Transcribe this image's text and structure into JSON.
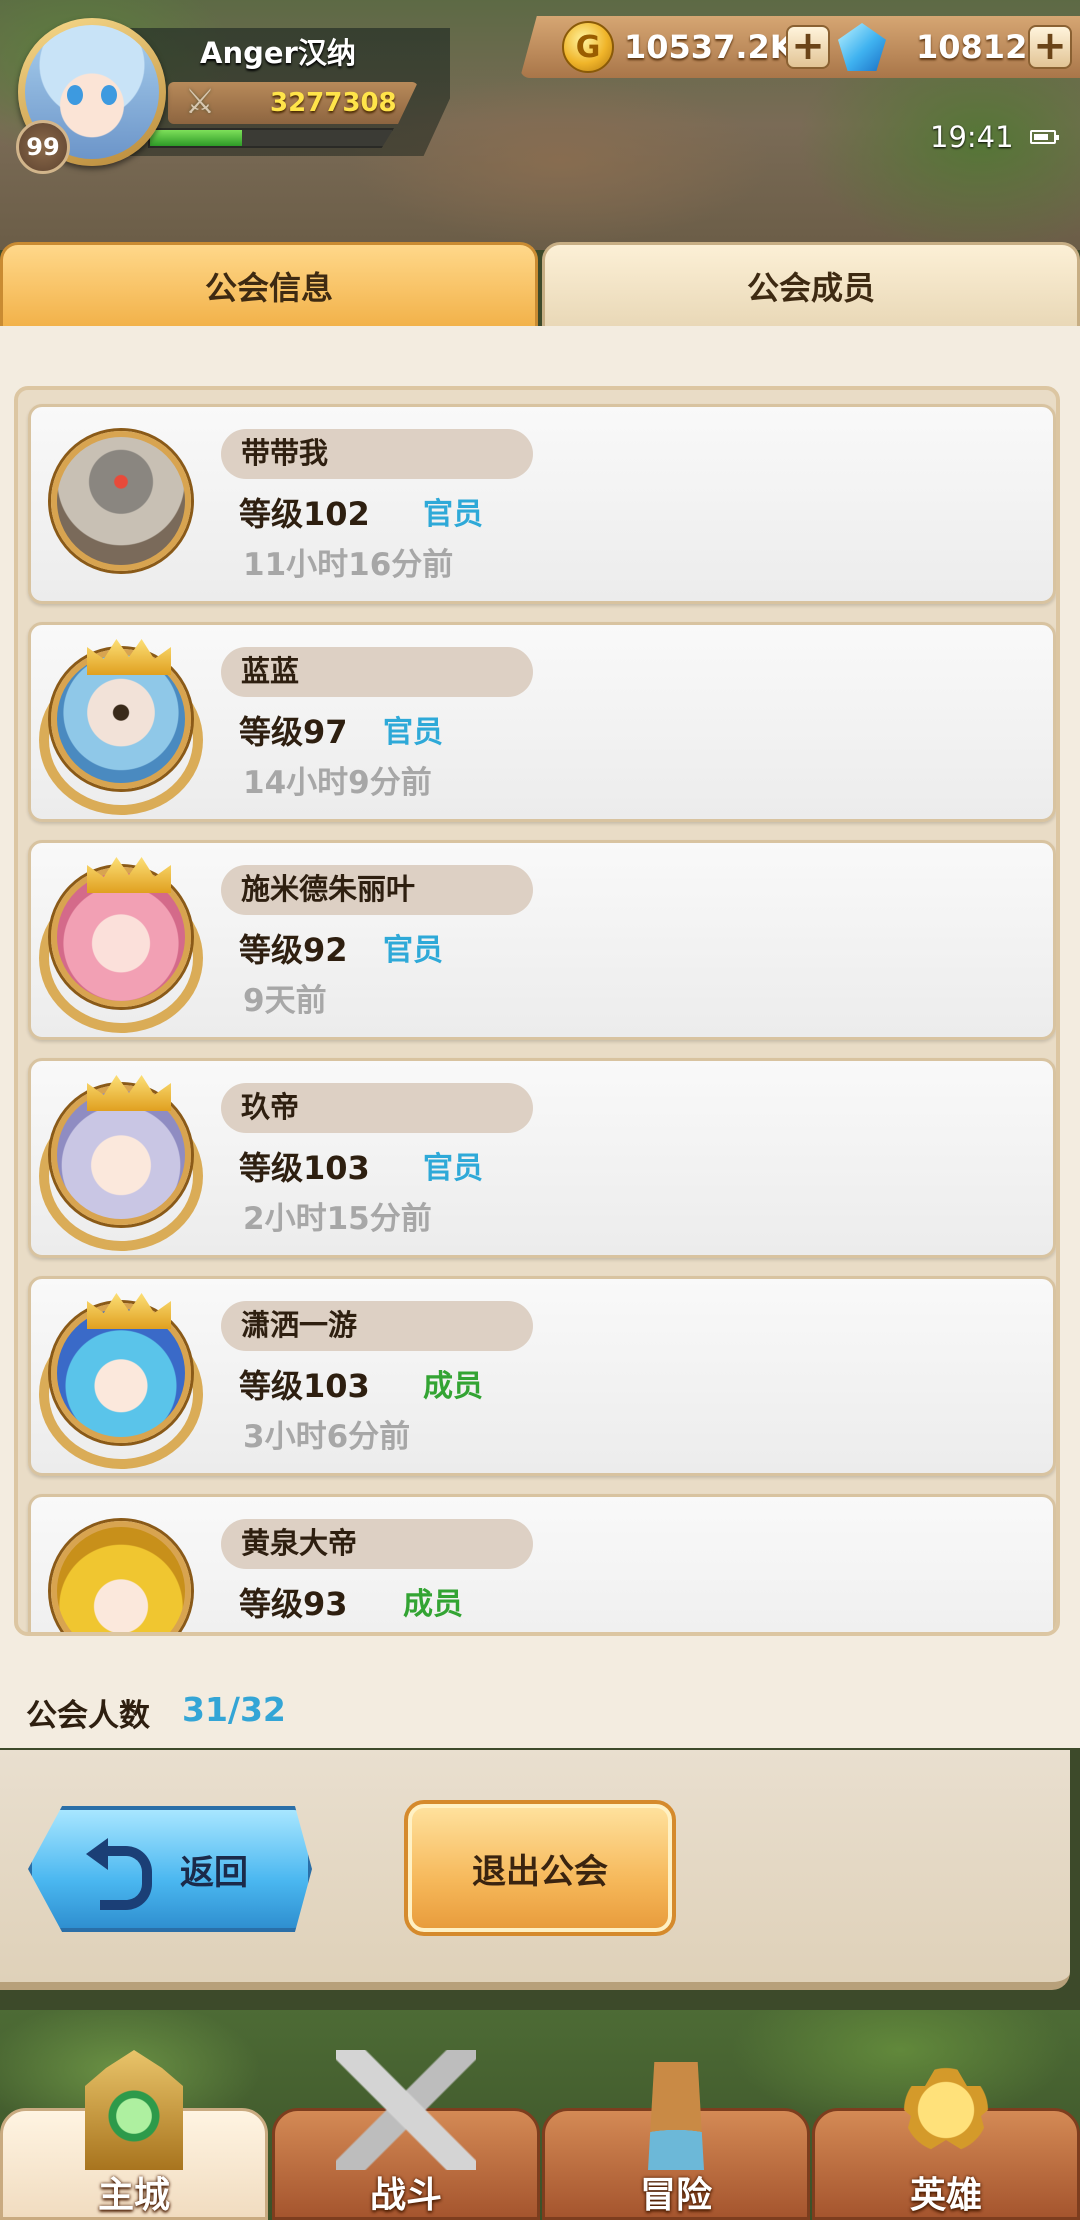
{
  "header": {
    "player_name": "Anger汉纳",
    "level": "99",
    "power": "3277308",
    "exp_fraction": 0.38,
    "gold": "10537.2K",
    "gems": "10812",
    "plus": "+",
    "time": "19:41",
    "gold_symbol": "G"
  },
  "tabs": [
    {
      "label": "公会信息",
      "active": true
    },
    {
      "label": "公会成员",
      "active": false
    }
  ],
  "members": [
    {
      "name": "带带我",
      "level": "等级102",
      "role": "官员",
      "role_type": "officer",
      "last_online": "11小时16分前",
      "avatar_icon": "robot-avatar-icon"
    },
    {
      "name": "蓝蓝",
      "level": "等级97",
      "role": "官员",
      "role_type": "officer",
      "last_online": "14小时9分前",
      "avatar_icon": "blindfold-girl-avatar-icon"
    },
    {
      "name": "施米德朱丽叶",
      "level": "等级92",
      "role": "官员",
      "role_type": "officer",
      "last_online": "9天前",
      "avatar_icon": "pink-hair-avatar-icon"
    },
    {
      "name": "玖帝",
      "level": "等级103",
      "role": "官员",
      "role_type": "officer",
      "last_online": "2小时15分前",
      "avatar_icon": "silver-hair-avatar-icon"
    },
    {
      "name": "潇洒一游",
      "level": "等级103",
      "role": "成员",
      "role_type": "member",
      "last_online": "3小时6分前",
      "avatar_icon": "blue-hood-avatar-icon"
    },
    {
      "name": "黄泉大帝",
      "level": "等级93",
      "role": "成员",
      "role_type": "member",
      "last_online": "",
      "avatar_icon": "blonde-avatar-icon"
    }
  ],
  "member_count": {
    "label": "公会人数",
    "value": "31/32"
  },
  "actions": {
    "back_label": "返回",
    "quit_label": "退出公会"
  },
  "nav": [
    {
      "label": "主城",
      "icon": "castle-icon",
      "active": true
    },
    {
      "label": "战斗",
      "icon": "swords-icon",
      "active": false
    },
    {
      "label": "冒险",
      "icon": "scroll-icon",
      "active": false
    },
    {
      "label": "英雄",
      "icon": "hero-emblem-icon",
      "active": false
    }
  ],
  "colors": {
    "officer": "#2ea9d8",
    "member": "#33a433",
    "count": "#33a5d6",
    "power": "#ffe44a"
  }
}
